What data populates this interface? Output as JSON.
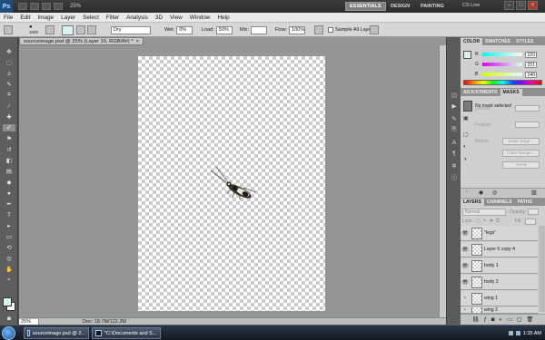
{
  "app": {
    "logo": "Ps",
    "zoom_readout": "25%",
    "workspaces": [
      "ESSENTIALS",
      "DESIGN",
      "PAINTING"
    ],
    "cs_live": "CS Live"
  },
  "menu": [
    "File",
    "Edit",
    "Image",
    "Layer",
    "Select",
    "Filter",
    "Analysis",
    "3D",
    "View",
    "Window",
    "Help"
  ],
  "options": {
    "brush_size": "1000",
    "preset": "Dry",
    "wet_label": "Wet:",
    "wet_value": "0%",
    "load_label": "Load:",
    "load_value": "50%",
    "mix_label": "Mix:",
    "flow_label": "Flow:",
    "flow_value": "100%",
    "sample_all_layers": "Sample All Layers"
  },
  "document": {
    "tab_title": "sourceimage.psd @ 25% (Layer 15, RGB/8#) *",
    "tab_close": "×",
    "zoom": "25%",
    "doc_info": "Doc: 18.7M/122.3M"
  },
  "color_panel": {
    "tabs": [
      "COLOR",
      "SWATCHES",
      "STYLES"
    ],
    "channels": [
      {
        "label": "R",
        "value": "220"
      },
      {
        "label": "G",
        "value": "251"
      },
      {
        "label": "B",
        "value": "240"
      }
    ],
    "foreground": "#dcfbf0"
  },
  "adjustments_panel": {
    "tabs": [
      "ADJUSTMENTS",
      "MASKS"
    ],
    "mask_status": "No mask selected",
    "density_label": "Density:",
    "feather_label": "Feather:",
    "refine_label": "Refine:",
    "mask_edge": "Mask Edge...",
    "color_range": "Color Range...",
    "invert": "Invert"
  },
  "layers_panel": {
    "tabs": [
      "LAYERS",
      "CHANNELS",
      "PATHS"
    ],
    "blend_mode": "Normal",
    "opacity_label": "Opacity:",
    "fill_label": "Fill:",
    "lock_label": "Lock:",
    "layers": [
      {
        "name": "\"legs\"",
        "visible": true
      },
      {
        "name": "Layer 6 copy 4",
        "visible": true
      },
      {
        "name": "body 1",
        "visible": true
      },
      {
        "name": "body 2",
        "visible": true
      },
      {
        "name": "wing 1",
        "visible": false
      },
      {
        "name": "wing 2",
        "visible": false
      }
    ]
  },
  "taskbar": {
    "tasks": [
      "sourceimage.psd @ 2...",
      "\"C:\\Documents and S..."
    ],
    "clock": "1:35 AM"
  },
  "colors": {
    "accent": "#7b8ea6",
    "foreground_swatch": "#d9f2ee"
  }
}
